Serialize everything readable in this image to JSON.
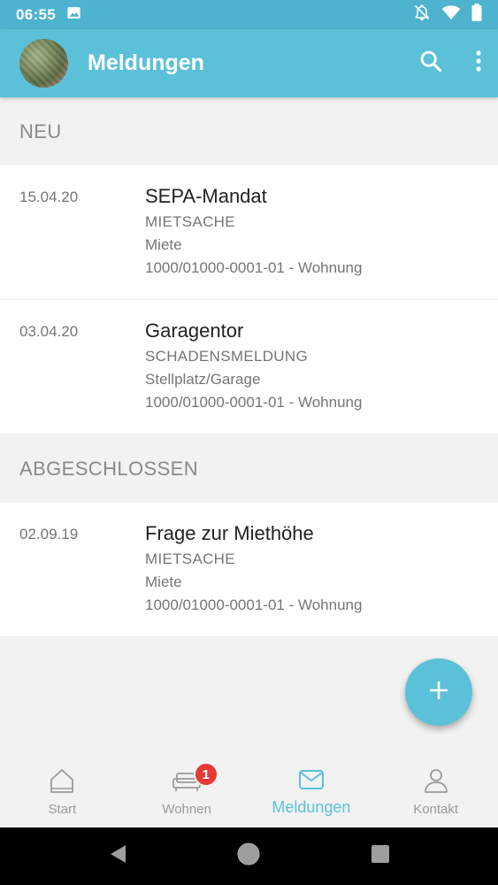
{
  "status_bar": {
    "time": "06:55",
    "icons": [
      "image-icon",
      "notifications-off-icon",
      "wifi-icon",
      "battery-icon"
    ]
  },
  "app_bar": {
    "title": "Meldungen",
    "actions": [
      "search-icon",
      "more-vert-icon"
    ]
  },
  "sections": [
    {
      "header": "NEU",
      "items": [
        {
          "date": "15.04.20",
          "subject": "SEPA-Mandat",
          "category": "MIETSACHE",
          "subcategory": "Miete",
          "unit": "1000/01000-0001-01 - Wohnung"
        },
        {
          "date": "03.04.20",
          "subject": "Garagentor",
          "category": "SCHADENSMELDUNG",
          "subcategory": "Stellplatz/Garage",
          "unit": "1000/01000-0001-01 - Wohnung"
        }
      ]
    },
    {
      "header": "ABGESCHLOSSEN",
      "items": [
        {
          "date": "02.09.19",
          "subject": "Frage zur Miethöhe",
          "category": "MIETSACHE",
          "subcategory": "Miete",
          "unit": "1000/01000-0001-01 - Wohnung"
        }
      ]
    }
  ],
  "fab": {
    "icon": "plus-icon"
  },
  "bottom_nav": {
    "items": [
      {
        "label": "Start",
        "icon": "home-icon",
        "active": false
      },
      {
        "label": "Wohnen",
        "icon": "sofa-icon",
        "active": false,
        "badge": "1"
      },
      {
        "label": "Meldungen",
        "icon": "mail-icon",
        "active": true
      },
      {
        "label": "Kontakt",
        "icon": "person-icon",
        "active": false
      }
    ]
  },
  "system_nav": [
    "back-icon",
    "home-circle-icon",
    "recents-icon"
  ],
  "colors": {
    "primary": "#5bc1d9",
    "status_bar": "#4db3cf",
    "badge": "#e53935",
    "muted_text": "#757575",
    "section_header": "#8a8a8a"
  }
}
